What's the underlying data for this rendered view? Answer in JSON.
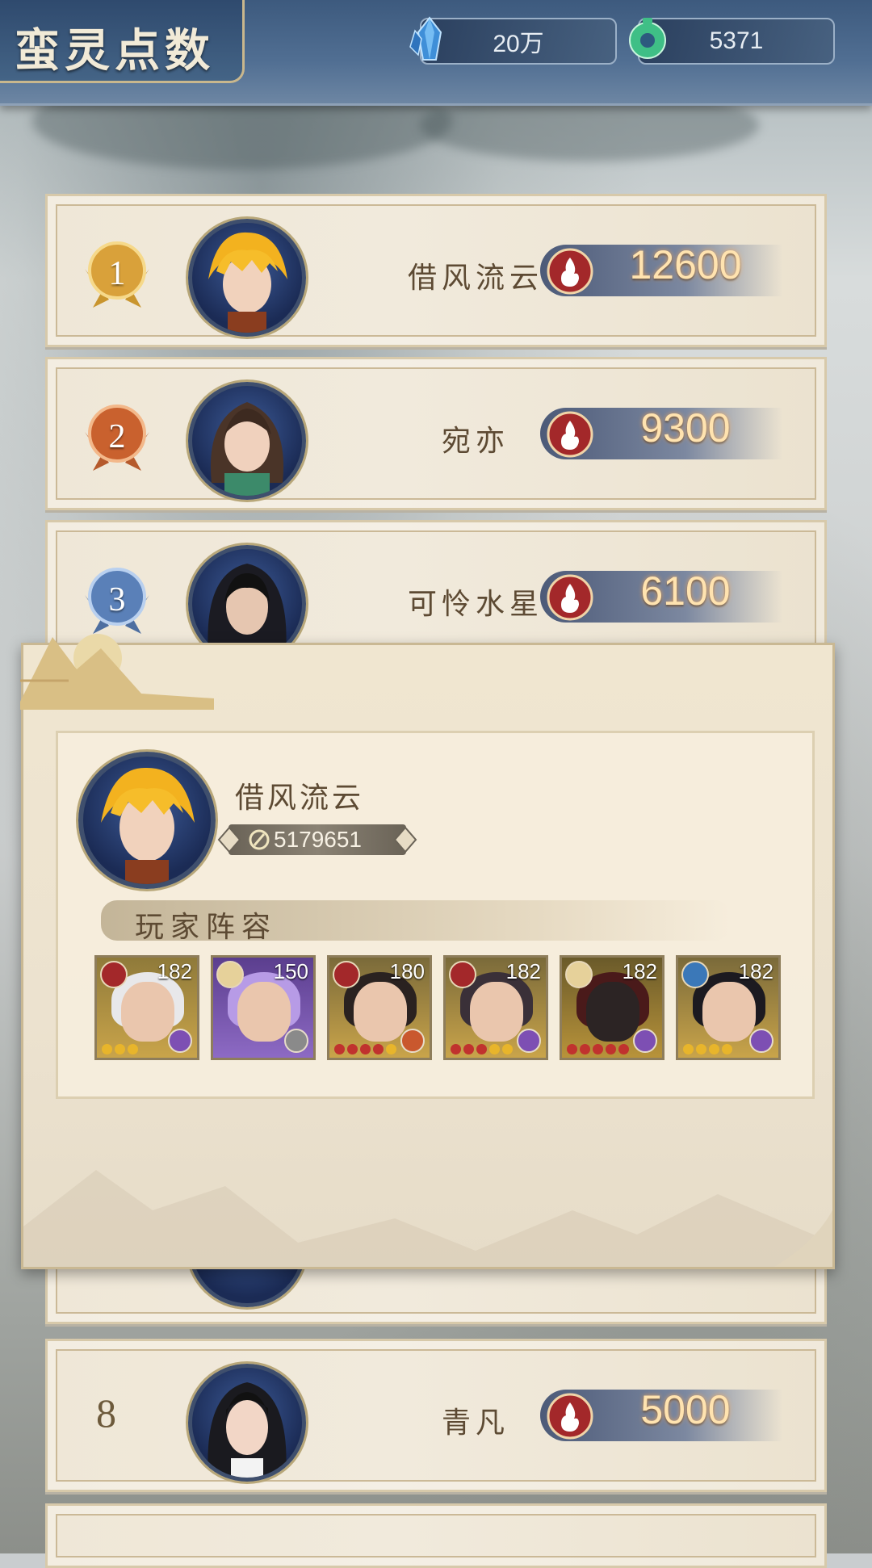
{
  "header": {
    "title": "蛮灵点数",
    "resources": [
      {
        "icon": "crystal-icon",
        "value": "20万"
      },
      {
        "icon": "jade-coin-icon",
        "value": "5371"
      }
    ]
  },
  "ranking": [
    {
      "rank": "1",
      "name": "借风流云",
      "score": "12600"
    },
    {
      "rank": "2",
      "name": "宛亦",
      "score": "9300"
    },
    {
      "rank": "3",
      "name": "可怜水星",
      "score": "6100"
    },
    {
      "rank": "8",
      "name": "青凡",
      "score": "5000"
    }
  ],
  "popup": {
    "player_name": "借风流云",
    "power": "5179651",
    "lineup_title": "玩家阵容",
    "heroes": [
      {
        "level": "182",
        "element": "fire"
      },
      {
        "level": "150",
        "element": "light"
      },
      {
        "level": "180",
        "element": "fire"
      },
      {
        "level": "182",
        "element": "fire"
      },
      {
        "level": "182",
        "element": "light"
      },
      {
        "level": "182",
        "element": "wind"
      }
    ]
  },
  "colors": {
    "header_bg": "#3d5a7e",
    "card_bg": "#efe7d7",
    "score_text": "#ffe3b0",
    "name_text": "#5d4a33"
  }
}
